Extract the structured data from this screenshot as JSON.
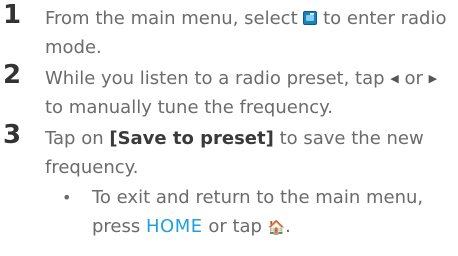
{
  "steps": [
    {
      "number": "1",
      "text_before_icon": "From the main menu, select ",
      "icon": "radio-mode-icon",
      "text_after_icon": " to enter radio mode."
    },
    {
      "number": "2",
      "text_before": "While you listen to a radio preset, tap ",
      "left_icon": "◀",
      "text_middle": " or ",
      "right_icon": "▶",
      "text_after": " to manually tune the frequency."
    },
    {
      "number": "3",
      "text_before": "Tap on ",
      "bold_label": "[Save to preset]",
      "text_after": " to save the new frequency."
    }
  ],
  "bullet": {
    "mark": "•",
    "text_before": "To exit and return to the main menu, press ",
    "home_label": "HOME",
    "text_middle": " or tap ",
    "home_icon": "🏠",
    "text_after": "."
  }
}
